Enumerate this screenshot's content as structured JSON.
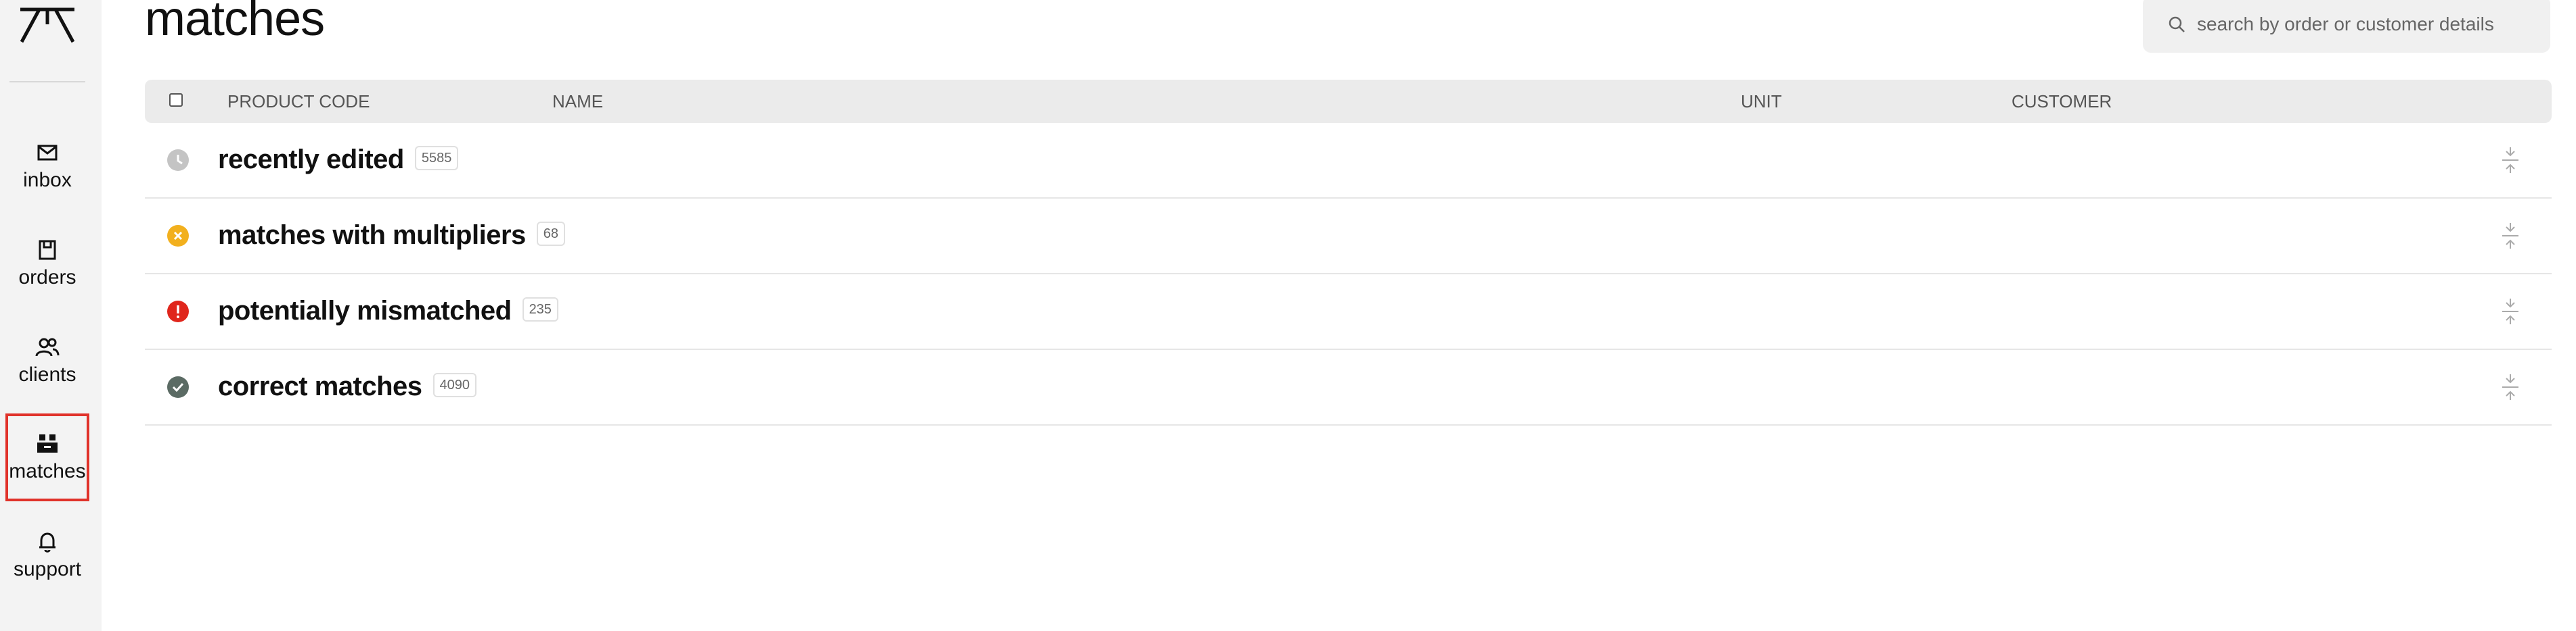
{
  "app": {
    "logo_icon": "app-logo-icon"
  },
  "sidebar": {
    "items": [
      {
        "label": "inbox",
        "icon": "mail-icon",
        "active": false
      },
      {
        "label": "orders",
        "icon": "box-icon",
        "active": false
      },
      {
        "label": "clients",
        "icon": "users-icon",
        "active": false
      },
      {
        "label": "matches",
        "icon": "matches-icon",
        "active": true
      },
      {
        "label": "support",
        "icon": "bell-icon",
        "active": false
      }
    ]
  },
  "header": {
    "title": "matches"
  },
  "search": {
    "placeholder": "search by order or customer details",
    "value": ""
  },
  "table": {
    "columns": [
      "PRODUCT CODE",
      "NAME",
      "UNIT",
      "CUSTOMER"
    ],
    "groups": [
      {
        "label": "recently edited",
        "count": "5585",
        "status_icon": "clock-icon",
        "color": "#c4c4c4"
      },
      {
        "label": "matches with multipliers",
        "count": "68",
        "status_icon": "x-circle-icon",
        "color": "#f2b01e"
      },
      {
        "label": "potentially mismatched",
        "count": "235",
        "status_icon": "alert-icon",
        "color": "#e0261c"
      },
      {
        "label": "correct matches",
        "count": "4090",
        "status_icon": "check-circle-icon",
        "color": "#5b6b64"
      }
    ]
  },
  "colors": {
    "active_outline": "#e0322a",
    "sidebar_bg": "#f3f3f3",
    "table_header_bg": "#ebebeb"
  }
}
